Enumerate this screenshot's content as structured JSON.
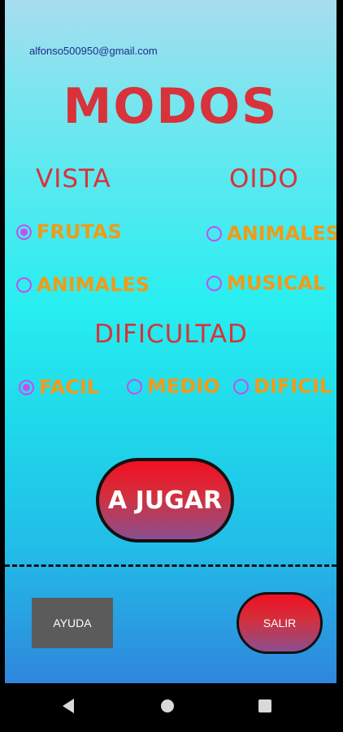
{
  "user": {
    "email": "alfonso500950@gmail.com"
  },
  "title": "MODOS",
  "vista": {
    "heading": "VISTA",
    "options": [
      {
        "label": "FRUTAS",
        "selected": true
      },
      {
        "label": "ANIMALES",
        "selected": false
      }
    ]
  },
  "oido": {
    "heading": "OIDO",
    "options": [
      {
        "label": "ANIMALES",
        "selected": false
      },
      {
        "label": "MUSICAL",
        "selected": false
      }
    ]
  },
  "dificultad": {
    "heading": "DIFICULTAD",
    "options": [
      {
        "label": "FACIL",
        "selected": true
      },
      {
        "label": "MEDIO",
        "selected": false
      },
      {
        "label": "DIFICIL",
        "selected": false
      }
    ]
  },
  "actions": {
    "play_label": "A JUGAR",
    "help_label": "AYUDA",
    "exit_label": "SALIR"
  },
  "colors": {
    "title": "#d8323a",
    "option_text": "#f29a17",
    "radio": "#c64ef0",
    "button_red": "#f10f23"
  },
  "navbar": {
    "back_icon": "back-triangle-icon",
    "home_icon": "home-circle-icon",
    "recent_icon": "recent-apps-square-icon"
  }
}
